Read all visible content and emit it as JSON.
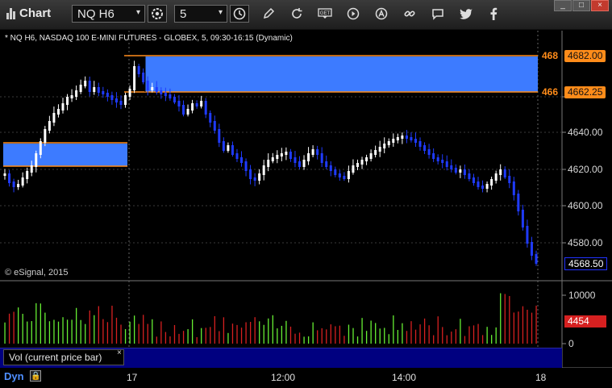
{
  "toolbar": {
    "app_title": "Chart",
    "symbol": "NQ H6",
    "interval": "5",
    "icons": [
      "circle-settings-icon",
      "clock-icon",
      "pencil-icon",
      "refresh-icon",
      "get-icon",
      "play-icon",
      "a-icon",
      "link-icon",
      "chat-icon",
      "twitter-icon",
      "facebook-icon"
    ]
  },
  "window": {
    "minimize": "_",
    "maximize": "□",
    "close": "×"
  },
  "chart": {
    "subtitle": "* NQ H6, NASDAQ 100 E-MINI FUTURES - GLOBEX, 5, 09:30-16:15 (Dynamic)",
    "copyright": "© eSignal, 2015",
    "price_axis": [
      "4640.00",
      "4620.00",
      "4600.00",
      "4580.00"
    ],
    "zone_upper_label_left": "468",
    "zone_upper_label": "4682.00",
    "zone_lower_label_left": "466",
    "zone_lower_label": "4662.25",
    "last_price": "4568.50",
    "volume_axis": [
      "10000",
      "0"
    ],
    "volume_last": "4454",
    "volume_panel_label": "Vol (current price bar)",
    "volume_panel_close": "×",
    "time_axis": [
      "17",
      "12:00",
      "14:00",
      "18"
    ],
    "mode": "Dyn",
    "colors": {
      "up": "#ffffff",
      "down": "#1f3bff",
      "zone": "#3d7bff",
      "zone_line": "#ff8c1a",
      "vol_up": "#66ee33",
      "vol_down": "#d62020"
    }
  }
}
